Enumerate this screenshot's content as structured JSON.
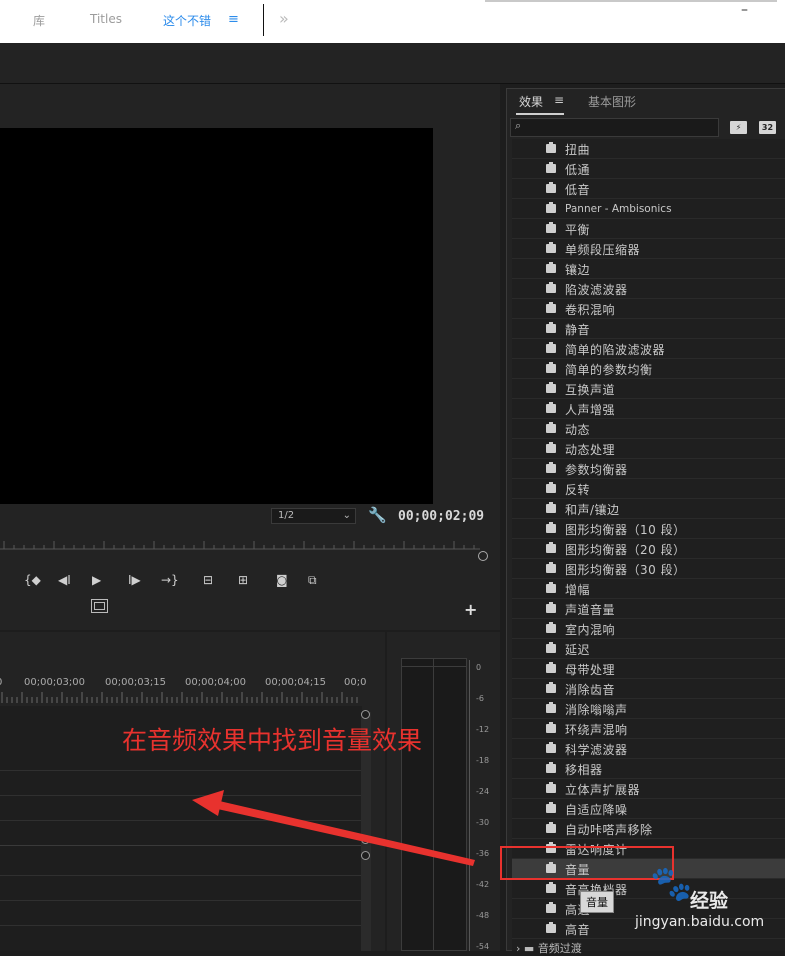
{
  "window": {
    "minimize_glyph": "–"
  },
  "tabs": {
    "library": "库",
    "titles": "Titles",
    "current": "这个不错",
    "menu_glyph": "≡",
    "more_glyph": "»"
  },
  "monitor": {
    "resolution": "1/2",
    "timecode": "00;00;02;09",
    "controls": [
      {
        "name": "mark-in-icon",
        "glyph": "{◆"
      },
      {
        "name": "step-back-icon",
        "glyph": "◀I"
      },
      {
        "name": "play-icon",
        "glyph": "▶"
      },
      {
        "name": "step-forward-icon",
        "glyph": "I▶"
      },
      {
        "name": "go-to-out-icon",
        "glyph": "→}"
      },
      {
        "name": "lift-icon",
        "glyph": "⊟"
      },
      {
        "name": "extract-icon",
        "glyph": "⊞"
      },
      {
        "name": "camera-icon",
        "glyph": "◙"
      },
      {
        "name": "compare-icon",
        "glyph": "⧉"
      }
    ],
    "plus_glyph": "+"
  },
  "timeline": {
    "ruler_labels": [
      "0",
      "00;00;03;00",
      "00;00;03;15",
      "00;00;04;00",
      "00;00;04;15",
      "00;0"
    ]
  },
  "meter": {
    "db_labels": [
      "0",
      "-6",
      "-12",
      "-18",
      "-24",
      "-30",
      "-36",
      "-42",
      "-48",
      "-54"
    ]
  },
  "effects_panel": {
    "tab_effects": "效果",
    "tab_menu_glyph": "≡",
    "tab_graphics": "基本图形",
    "search_value": "",
    "search_icon": "⌕",
    "badge_accel": "⚡",
    "badge_32": "32",
    "items": [
      "扭曲",
      "低通",
      "低音",
      "Panner - Ambisonics",
      "平衡",
      "单频段压缩器",
      "镶边",
      "陷波滤波器",
      "卷积混响",
      "静音",
      "简单的陷波滤波器",
      "简单的参数均衡",
      "互换声道",
      "人声增强",
      "动态",
      "动态处理",
      "参数均衡器",
      "反转",
      "和声/镶边",
      "图形均衡器（10 段）",
      "图形均衡器（20 段）",
      "图形均衡器（30 段）",
      "增幅",
      "声道音量",
      "室内混响",
      "延迟",
      "母带处理",
      "消除齿音",
      "消除嗡嗡声",
      "环绕声混响",
      "科学滤波器",
      "移相器",
      "立体声扩展器",
      "自适应降噪",
      "自动咔嗒声移除",
      "雷达响度计",
      "音量",
      "音高换档器",
      "高通",
      "高音"
    ],
    "selected_item": "音量",
    "tooltip": "音量",
    "folder": "音频过渡"
  },
  "annotation": {
    "text": "在音频效果中找到音量效果",
    "color": "#e8322e"
  },
  "watermark": {
    "logo": "🐾",
    "brand": "经验",
    "url": "jingyan.baidu.com"
  },
  "colors": {
    "accent_blue": "#2d8ceb",
    "panel_bg": "#232323",
    "annotation_red": "#e8322e"
  }
}
